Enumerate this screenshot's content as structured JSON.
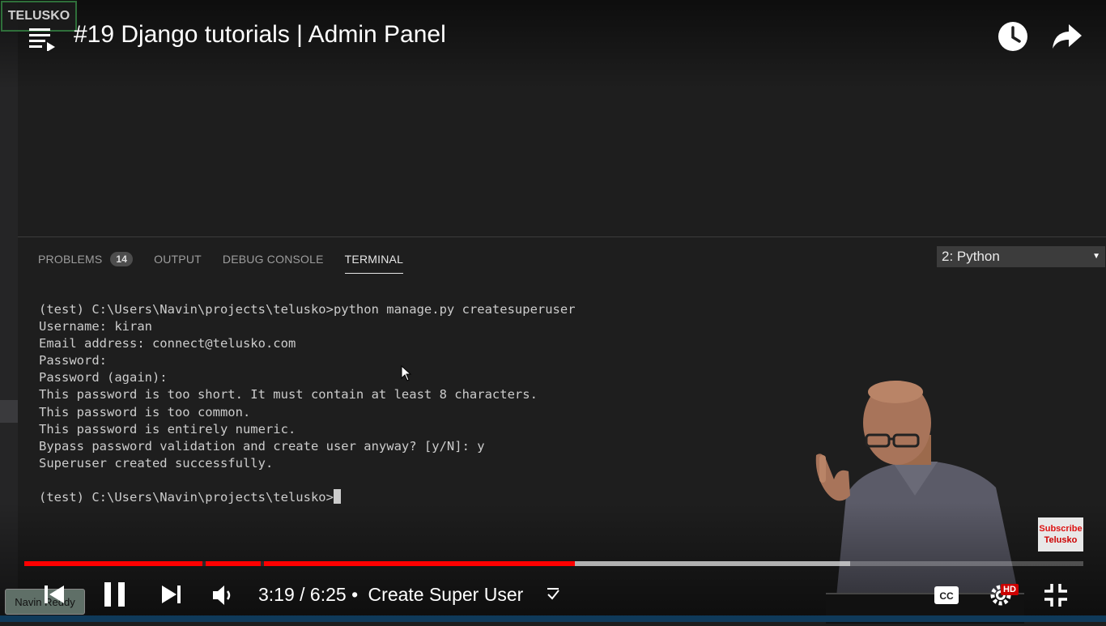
{
  "video": {
    "title": "#19 Django tutorials | Admin Panel",
    "channel_logo_text": "TELUSKO",
    "presenter_name_tag": "Navin Reddy",
    "subscribe_card": {
      "line1": "Subscribe",
      "line2": "Telusko"
    }
  },
  "panel": {
    "tabs": [
      {
        "label": "PROBLEMS",
        "badge": "14"
      },
      {
        "label": "OUTPUT"
      },
      {
        "label": "DEBUG CONSOLE"
      },
      {
        "label": "TERMINAL"
      }
    ],
    "active_tab": "TERMINAL",
    "terminal_select": "2: Python"
  },
  "terminal": {
    "lines": [
      "(test) C:\\Users\\Navin\\projects\\telusko>python manage.py createsuperuser",
      "Username: kiran",
      "Email address: connect@telusko.com",
      "Password:",
      "Password (again):",
      "This password is too short. It must contain at least 8 characters.",
      "This password is too common.",
      "This password is entirely numeric.",
      "Bypass password validation and create user anyway? [y/N]: y",
      "Superuser created successfully.",
      "",
      "(test) C:\\Users\\Navin\\projects\\telusko>"
    ]
  },
  "player": {
    "current_time": "3:19",
    "duration": "6:25",
    "time_display": "3:19 / 6:25",
    "separator": "•",
    "chapter": "Create Super User",
    "played_fraction": 0.52,
    "loaded_fraction": 0.78,
    "hd_badge": "HD",
    "icons": [
      "previous-icon",
      "pause-icon",
      "next-icon",
      "volume-icon",
      "chapter-chevron-icon",
      "captions-icon",
      "settings-icon",
      "exit-fullscreen-icon",
      "playlist-icon",
      "watch-later-icon",
      "share-icon"
    ],
    "colors": {
      "progress_played": "#ff0000",
      "hd_badge": "#cc0000"
    }
  }
}
